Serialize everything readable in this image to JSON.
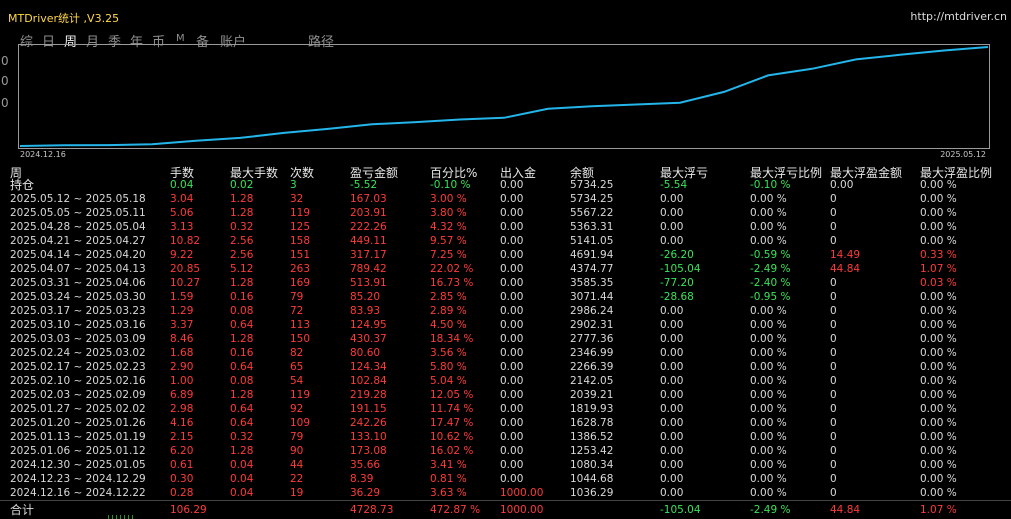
{
  "window": {
    "title": "MTDriver统计 ,V3.25",
    "url": "http://mtdriver.cn"
  },
  "tabs": [
    {
      "label": "综",
      "active": false
    },
    {
      "label": "日",
      "active": false
    },
    {
      "label": "周",
      "active": true
    },
    {
      "label": "月",
      "active": false
    },
    {
      "label": "季",
      "active": false
    },
    {
      "label": "年",
      "active": false
    },
    {
      "label": "币",
      "active": false
    },
    {
      "label": "M",
      "active": false
    },
    {
      "label": "备",
      "active": false
    },
    {
      "label": "账户",
      "active": false
    },
    {
      "label": "路径",
      "active": false
    }
  ],
  "left_edge_glyphs": [
    "0",
    "0",
    "0"
  ],
  "chart": {
    "x_start_label": "2024.12.16",
    "x_end_label": "2025.05.12",
    "line_color": "#24b5ea"
  },
  "chart_data": {
    "type": "line",
    "x": [
      "2024.12.16",
      "2024.12.23",
      "2024.12.30",
      "2025.01.06",
      "2025.01.13",
      "2025.01.20",
      "2025.01.27",
      "2025.02.03",
      "2025.02.10",
      "2025.02.17",
      "2025.02.24",
      "2025.03.03",
      "2025.03.10",
      "2025.03.17",
      "2025.03.24",
      "2025.03.31",
      "2025.04.07",
      "2025.04.14",
      "2025.04.21",
      "2025.04.28",
      "2025.05.05",
      "2025.05.12"
    ],
    "series": [
      {
        "values": [
          1000,
          1036.29,
          1044.68,
          1080.34,
          1253.42,
          1386.52,
          1628.78,
          1819.93,
          2039.21,
          2142.05,
          2266.39,
          2346.99,
          2777.36,
          2902.31,
          2986.24,
          3071.44,
          3585.35,
          4374.77,
          4691.94,
          5141.05,
          5363.31,
          5567.22,
          5734.25
        ]
      }
    ]
  },
  "table": {
    "headers": [
      "周",
      "手数",
      "最大手数",
      "次数",
      "盈亏金额",
      "百分比%",
      "出入金",
      "余额",
      "最大浮亏",
      "最大浮亏比例",
      "最大浮盈金额",
      "最大浮盈比例"
    ],
    "holding": [
      "持仓",
      "0.04",
      "0.02",
      "3",
      "-5.52",
      "-0.10 %",
      "0.00",
      "5734.25",
      "-5.54",
      "-0.10 %",
      "0.00",
      "0.00 %"
    ],
    "rows": [
      [
        "2025.05.12 ~ 2025.05.18",
        "3.04",
        "1.28",
        "32",
        "167.03",
        "3.00 %",
        "0.00",
        "5734.25",
        "0.00",
        "0.00 %",
        "0",
        "0.00 %"
      ],
      [
        "2025.05.05 ~ 2025.05.11",
        "5.06",
        "1.28",
        "119",
        "203.91",
        "3.80 %",
        "0.00",
        "5567.22",
        "0.00",
        "0.00 %",
        "0",
        "0.00 %"
      ],
      [
        "2025.04.28 ~ 2025.05.04",
        "3.13",
        "0.32",
        "125",
        "222.26",
        "4.32 %",
        "0.00",
        "5363.31",
        "0.00",
        "0.00 %",
        "0",
        "0.00 %"
      ],
      [
        "2025.04.21 ~ 2025.04.27",
        "10.82",
        "2.56",
        "158",
        "449.11",
        "9.57 %",
        "0.00",
        "5141.05",
        "0.00",
        "0.00 %",
        "0",
        "0.00 %"
      ],
      [
        "2025.04.14 ~ 2025.04.20",
        "9.22",
        "2.56",
        "151",
        "317.17",
        "7.25 %",
        "0.00",
        "4691.94",
        "-26.20",
        "-0.59 %",
        "14.49",
        "0.33 %"
      ],
      [
        "2025.04.07 ~ 2025.04.13",
        "20.85",
        "5.12",
        "263",
        "789.42",
        "22.02 %",
        "0.00",
        "4374.77",
        "-105.04",
        "-2.49 %",
        "44.84",
        "1.07 %"
      ],
      [
        "2025.03.31 ~ 2025.04.06",
        "10.27",
        "1.28",
        "169",
        "513.91",
        "16.73 %",
        "0.00",
        "3585.35",
        "-77.20",
        "-2.40 %",
        "0",
        "0.03 %"
      ],
      [
        "2025.03.24 ~ 2025.03.30",
        "1.59",
        "0.16",
        "79",
        "85.20",
        "2.85 %",
        "0.00",
        "3071.44",
        "-28.68",
        "-0.95 %",
        "0",
        "0.00 %"
      ],
      [
        "2025.03.17 ~ 2025.03.23",
        "1.29",
        "0.08",
        "72",
        "83.93",
        "2.89 %",
        "0.00",
        "2986.24",
        "0.00",
        "0.00 %",
        "0",
        "0.00 %"
      ],
      [
        "2025.03.10 ~ 2025.03.16",
        "3.37",
        "0.64",
        "113",
        "124.95",
        "4.50 %",
        "0.00",
        "2902.31",
        "0.00",
        "0.00 %",
        "0",
        "0.00 %"
      ],
      [
        "2025.03.03 ~ 2025.03.09",
        "8.46",
        "1.28",
        "150",
        "430.37",
        "18.34 %",
        "0.00",
        "2777.36",
        "0.00",
        "0.00 %",
        "0",
        "0.00 %"
      ],
      [
        "2025.02.24 ~ 2025.03.02",
        "1.68",
        "0.16",
        "82",
        "80.60",
        "3.56 %",
        "0.00",
        "2346.99",
        "0.00",
        "0.00 %",
        "0",
        "0.00 %"
      ],
      [
        "2025.02.17 ~ 2025.02.23",
        "2.90",
        "0.64",
        "65",
        "124.34",
        "5.80 %",
        "0.00",
        "2266.39",
        "0.00",
        "0.00 %",
        "0",
        "0.00 %"
      ],
      [
        "2025.02.10 ~ 2025.02.16",
        "1.00",
        "0.08",
        "54",
        "102.84",
        "5.04 %",
        "0.00",
        "2142.05",
        "0.00",
        "0.00 %",
        "0",
        "0.00 %"
      ],
      [
        "2025.02.03 ~ 2025.02.09",
        "6.89",
        "1.28",
        "119",
        "219.28",
        "12.05 %",
        "0.00",
        "2039.21",
        "0.00",
        "0.00 %",
        "0",
        "0.00 %"
      ],
      [
        "2025.01.27 ~ 2025.02.02",
        "2.98",
        "0.64",
        "92",
        "191.15",
        "11.74 %",
        "0.00",
        "1819.93",
        "0.00",
        "0.00 %",
        "0",
        "0.00 %"
      ],
      [
        "2025.01.20 ~ 2025.01.26",
        "4.16",
        "0.64",
        "109",
        "242.26",
        "17.47 %",
        "0.00",
        "1628.78",
        "0.00",
        "0.00 %",
        "0",
        "0.00 %"
      ],
      [
        "2025.01.13 ~ 2025.01.19",
        "2.15",
        "0.32",
        "79",
        "133.10",
        "10.62 %",
        "0.00",
        "1386.52",
        "0.00",
        "0.00 %",
        "0",
        "0.00 %"
      ],
      [
        "2025.01.06 ~ 2025.01.12",
        "6.20",
        "1.28",
        "90",
        "173.08",
        "16.02 %",
        "0.00",
        "1253.42",
        "0.00",
        "0.00 %",
        "0",
        "0.00 %"
      ],
      [
        "2024.12.30 ~ 2025.01.05",
        "0.61",
        "0.04",
        "44",
        "35.66",
        "3.41 %",
        "0.00",
        "1080.34",
        "0.00",
        "0.00 %",
        "0",
        "0.00 %"
      ],
      [
        "2024.12.23 ~ 2024.12.29",
        "0.30",
        "0.04",
        "22",
        "8.39",
        "0.81 %",
        "0.00",
        "1044.68",
        "0.00",
        "0.00 %",
        "0",
        "0.00 %"
      ],
      [
        "2024.12.16 ~ 2024.12.22",
        "0.28",
        "0.04",
        "19",
        "36.29",
        "3.63 %",
        "1000.00",
        "1036.29",
        "0.00",
        "0.00 %",
        "0",
        "0.00 %"
      ]
    ],
    "total": [
      "合计",
      "106.29",
      "",
      "",
      "4728.73",
      "472.87 %",
      "1000.00",
      "",
      "-105.04",
      "-2.49 %",
      "44.84",
      "1.07 %"
    ]
  },
  "colors": {
    "title": "#ffd84a",
    "header": "#e8e8e8",
    "neutral": "#d8d8d8",
    "profit_red": "#ff3a3a",
    "loss_green": "#39e35a",
    "chart_line": "#24b5ea",
    "chart_frame": "#9a9a9a"
  }
}
